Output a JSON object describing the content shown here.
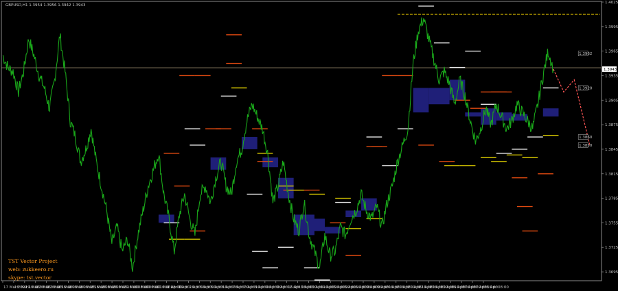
{
  "window": {
    "title": "GBPUSD,H1  1.3954 1.3956 1.3942 1.3943"
  },
  "watermark": {
    "line1": "TST Vector Project",
    "line2": "web: zukkeero.ru",
    "line3": "skype: tst.vector"
  },
  "colors": {
    "background": "#000000",
    "price": "#1aa81a",
    "zone": "#1f1f78",
    "support_yellow": "#d8c800",
    "resistance_red": "#e04a10",
    "white_level": "#e8e8e8",
    "projection": "#ff5555",
    "hline": "#c0a060"
  },
  "chart_data": {
    "type": "line",
    "symbol": "GBPUSD",
    "timeframe": "H1",
    "ylim": [
      1.3685,
      1.4025
    ],
    "y_ticks": [
      "1.4025",
      "1.3995",
      "1.3965",
      "1.3943",
      "1.3935",
      "1.3905",
      "1.3875",
      "1.3845",
      "1.3815",
      "1.3785",
      "1.3755",
      "1.3725",
      "1.3695"
    ],
    "x_ticks": [
      "17 Mar 2021",
      "18 Mar 16:00",
      "19 Mar 08:00",
      "22 Mar 00:00",
      "22 Mar 16:00",
      "23 Mar 08:00",
      "24 Mar 00:00",
      "24 Mar 16:00",
      "25 Mar 08:00",
      "26 Mar 00:00",
      "26 Mar 16:00",
      "29 Mar 08:00",
      "30 Mar 00:00",
      "30 Mar 16:00",
      "31 Mar 08:00",
      "1 Apr 00:00",
      "1 Apr 16:00",
      "2 Apr 08:00",
      "5 Apr 00:00",
      "5 Apr 16:00",
      "6 Apr 08:00",
      "7 Apr 00:00",
      "7 Apr 16:00",
      "8 Apr 08:00",
      "9 Apr 00:00",
      "9 Apr 16:00",
      "12 Apr 08:00",
      "13 Apr 00:00",
      "13 Apr 16:00",
      "14 Apr 08:00",
      "15 Apr 00:00",
      "15 Apr 16:00",
      "16 Apr 08:00",
      "19 Apr 00:00",
      "19 Apr 16:00",
      "20 Apr 08:00",
      "21 Apr 00:00",
      "21 Apr 16:00",
      "22 Apr 08:00",
      "23 Apr 00:00",
      "23 Apr 16:00",
      "26 Apr 08:00",
      "27 Apr 00:00",
      "27 Apr 16:00",
      "28 Apr 08:00"
    ],
    "current_price": "1.3943",
    "price_series": [
      [
        0,
        1.396
      ],
      [
        1,
        1.3945
      ],
      [
        2,
        1.394
      ],
      [
        3,
        1.3915
      ],
      [
        4,
        1.394
      ],
      [
        5,
        1.398
      ],
      [
        6,
        1.396
      ],
      [
        7,
        1.3935
      ],
      [
        8,
        1.392
      ],
      [
        9,
        1.3895
      ],
      [
        10,
        1.393
      ],
      [
        11,
        1.3985
      ],
      [
        12,
        1.394
      ],
      [
        13,
        1.388
      ],
      [
        14,
        1.386
      ],
      [
        15,
        1.383
      ],
      [
        16,
        1.3845
      ],
      [
        17,
        1.387
      ],
      [
        18,
        1.383
      ],
      [
        19,
        1.38
      ],
      [
        20,
        1.377
      ],
      [
        21,
        1.373
      ],
      [
        22,
        1.375
      ],
      [
        23,
        1.372
      ],
      [
        24,
        1.3735
      ],
      [
        25,
        1.37
      ],
      [
        26,
        1.374
      ],
      [
        27,
        1.377
      ],
      [
        28,
        1.38
      ],
      [
        29,
        1.382
      ],
      [
        30,
        1.384
      ],
      [
        31,
        1.379
      ],
      [
        32,
        1.376
      ],
      [
        33,
        1.372
      ],
      [
        34,
        1.3765
      ],
      [
        35,
        1.379
      ],
      [
        36,
        1.376
      ],
      [
        37,
        1.374
      ],
      [
        38,
        1.379
      ],
      [
        39,
        1.38
      ],
      [
        40,
        1.378
      ],
      [
        41,
        1.381
      ],
      [
        42,
        1.383
      ],
      [
        43,
        1.38
      ],
      [
        44,
        1.379
      ],
      [
        45,
        1.383
      ],
      [
        46,
        1.3845
      ],
      [
        47,
        1.388
      ],
      [
        48,
        1.39
      ],
      [
        49,
        1.3885
      ],
      [
        50,
        1.387
      ],
      [
        51,
        1.384
      ],
      [
        52,
        1.378
      ],
      [
        53,
        1.38
      ],
      [
        54,
        1.383
      ],
      [
        55,
        1.379
      ],
      [
        56,
        1.376
      ],
      [
        57,
        1.3745
      ],
      [
        58,
        1.378
      ],
      [
        59,
        1.374
      ],
      [
        60,
        1.372
      ],
      [
        61,
        1.37
      ],
      [
        62,
        1.374
      ],
      [
        63,
        1.3715
      ],
      [
        64,
        1.372
      ],
      [
        65,
        1.375
      ],
      [
        66,
        1.374
      ],
      [
        67,
        1.376
      ],
      [
        68,
        1.377
      ],
      [
        69,
        1.379
      ],
      [
        70,
        1.377
      ],
      [
        71,
        1.376
      ],
      [
        72,
        1.3775
      ],
      [
        73,
        1.375
      ],
      [
        74,
        1.378
      ],
      [
        75,
        1.38
      ],
      [
        76,
        1.383
      ],
      [
        77,
        1.385
      ],
      [
        78,
        1.387
      ],
      [
        79,
        1.395
      ],
      [
        80,
        1.399
      ],
      [
        81,
        1.4005
      ],
      [
        82,
        1.398
      ],
      [
        83,
        1.3955
      ],
      [
        84,
        1.393
      ],
      [
        85,
        1.394
      ],
      [
        86,
        1.3925
      ],
      [
        87,
        1.39
      ],
      [
        88,
        1.393
      ],
      [
        89,
        1.391
      ],
      [
        90,
        1.388
      ],
      [
        91,
        1.3855
      ],
      [
        92,
        1.387
      ],
      [
        93,
        1.3895
      ],
      [
        94,
        1.3875
      ],
      [
        95,
        1.39
      ],
      [
        96,
        1.3885
      ],
      [
        97,
        1.387
      ],
      [
        98,
        1.388
      ],
      [
        99,
        1.39
      ],
      [
        100,
        1.389
      ],
      [
        101,
        1.388
      ],
      [
        102,
        1.387
      ],
      [
        103,
        1.39
      ],
      [
        104,
        1.3935
      ],
      [
        105,
        1.3965
      ],
      [
        106,
        1.3943
      ]
    ],
    "projection": [
      [
        106,
        1.3943
      ],
      [
        108,
        1.3915
      ],
      [
        110,
        1.393
      ],
      [
        113,
        1.385
      ]
    ],
    "resistance_line": {
      "from": 76,
      "to": 115,
      "y": 1.401
    },
    "projection_labels": [
      {
        "x": 110,
        "y": 1.3962,
        "text": "1.3962"
      },
      {
        "x": 110,
        "y": 1.392,
        "text": "1.3920"
      },
      {
        "x": 110,
        "y": 1.386,
        "text": "1.3860"
      },
      {
        "x": 110,
        "y": 1.385,
        "text": "1.3850"
      }
    ],
    "zones": [
      {
        "x0": 30,
        "x1": 33,
        "y0": 1.3765,
        "y1": 1.3755
      },
      {
        "x0": 40,
        "x1": 43,
        "y0": 1.3835,
        "y1": 1.382
      },
      {
        "x0": 46,
        "x1": 49,
        "y0": 1.386,
        "y1": 1.3845
      },
      {
        "x0": 50,
        "x1": 53,
        "y0": 1.3835,
        "y1": 1.3823
      },
      {
        "x0": 53,
        "x1": 56,
        "y0": 1.381,
        "y1": 1.3785
      },
      {
        "x0": 56,
        "x1": 60,
        "y0": 1.3765,
        "y1": 1.374
      },
      {
        "x0": 59,
        "x1": 62,
        "y0": 1.376,
        "y1": 1.3745
      },
      {
        "x0": 62,
        "x1": 65,
        "y0": 1.375,
        "y1": 1.3742
      },
      {
        "x0": 66,
        "x1": 69,
        "y0": 1.377,
        "y1": 1.3762
      },
      {
        "x0": 69,
        "x1": 72,
        "y0": 1.3785,
        "y1": 1.377
      },
      {
        "x0": 79,
        "x1": 82,
        "y0": 1.392,
        "y1": 1.389
      },
      {
        "x0": 82,
        "x1": 86,
        "y0": 1.392,
        "y1": 1.39
      },
      {
        "x0": 86,
        "x1": 89,
        "y0": 1.393,
        "y1": 1.3905
      },
      {
        "x0": 89,
        "x1": 92,
        "y0": 1.389,
        "y1": 1.3885
      },
      {
        "x0": 92,
        "x1": 95,
        "y0": 1.3895,
        "y1": 1.3875
      },
      {
        "x0": 95,
        "x1": 98,
        "y0": 1.389,
        "y1": 1.388
      },
      {
        "x0": 98,
        "x1": 101,
        "y0": 1.3888,
        "y1": 1.388
      },
      {
        "x0": 104,
        "x1": 107,
        "y0": 1.3895,
        "y1": 1.3885
      }
    ],
    "levels_red": [
      [
        43,
        46,
        1.3985
      ],
      [
        31,
        34,
        1.384
      ],
      [
        34,
        37,
        1.3935
      ],
      [
        37,
        40,
        1.3935
      ],
      [
        41,
        44,
        1.387
      ],
      [
        48,
        51,
        1.387
      ],
      [
        49,
        52,
        1.383
      ],
      [
        54,
        57,
        1.3795
      ],
      [
        56,
        59,
        1.3795
      ],
      [
        58,
        61,
        1.3795
      ],
      [
        63,
        66,
        1.3755
      ],
      [
        66,
        69,
        1.3715
      ],
      [
        70,
        73,
        1.3848
      ],
      [
        71,
        74,
        1.3848
      ],
      [
        73,
        76,
        1.3935
      ],
      [
        76,
        79,
        1.3935
      ],
      [
        80,
        83,
        1.385
      ],
      [
        84,
        87,
        1.383
      ],
      [
        87,
        90,
        1.3905
      ],
      [
        90,
        93,
        1.3895
      ],
      [
        92,
        95,
        1.3915
      ],
      [
        94,
        97,
        1.3915
      ],
      [
        95,
        98,
        1.3915
      ],
      [
        98,
        101,
        1.381
      ],
      [
        99,
        102,
        1.3775
      ],
      [
        100,
        103,
        1.3745
      ],
      [
        103,
        106,
        1.3815
      ],
      [
        33,
        36,
        1.38
      ],
      [
        36,
        39,
        1.3745
      ],
      [
        43,
        46,
        1.395
      ],
      [
        39,
        42,
        1.387
      ]
    ],
    "levels_yellow": [
      [
        44,
        47,
        1.392
      ],
      [
        49,
        52,
        1.384
      ],
      [
        53,
        56,
        1.38
      ],
      [
        55,
        58,
        1.3795
      ],
      [
        59,
        62,
        1.379
      ],
      [
        64,
        67,
        1.3785
      ],
      [
        66,
        69,
        1.3748
      ],
      [
        70,
        73,
        1.376
      ],
      [
        32,
        35,
        1.3735
      ],
      [
        35,
        38,
        1.3735
      ],
      [
        85,
        88,
        1.3825
      ],
      [
        88,
        91,
        1.3825
      ],
      [
        92,
        95,
        1.3835
      ],
      [
        94,
        97,
        1.383
      ],
      [
        97,
        100,
        1.3838
      ],
      [
        100,
        103,
        1.3835
      ],
      [
        104,
        107,
        1.3862
      ]
    ],
    "levels_white": [
      [
        42,
        45,
        1.391
      ],
      [
        36,
        39,
        1.385
      ],
      [
        35,
        38,
        1.387
      ],
      [
        31,
        34,
        1.3755
      ],
      [
        47,
        50,
        1.379
      ],
      [
        48,
        51,
        1.372
      ],
      [
        50,
        53,
        1.37
      ],
      [
        53,
        56,
        1.3725
      ],
      [
        58,
        61,
        1.37
      ],
      [
        60,
        63,
        1.3685
      ],
      [
        64,
        67,
        1.378
      ],
      [
        70,
        73,
        1.386
      ],
      [
        73,
        76,
        1.3825
      ],
      [
        76,
        79,
        1.387
      ],
      [
        80,
        83,
        1.402
      ],
      [
        83,
        86,
        1.3975
      ],
      [
        86,
        89,
        1.3945
      ],
      [
        89,
        92,
        1.3965
      ],
      [
        92,
        95,
        1.39
      ],
      [
        95,
        98,
        1.384
      ],
      [
        98,
        101,
        1.3845
      ],
      [
        101,
        104,
        1.386
      ],
      [
        104,
        107,
        1.392
      ]
    ]
  }
}
